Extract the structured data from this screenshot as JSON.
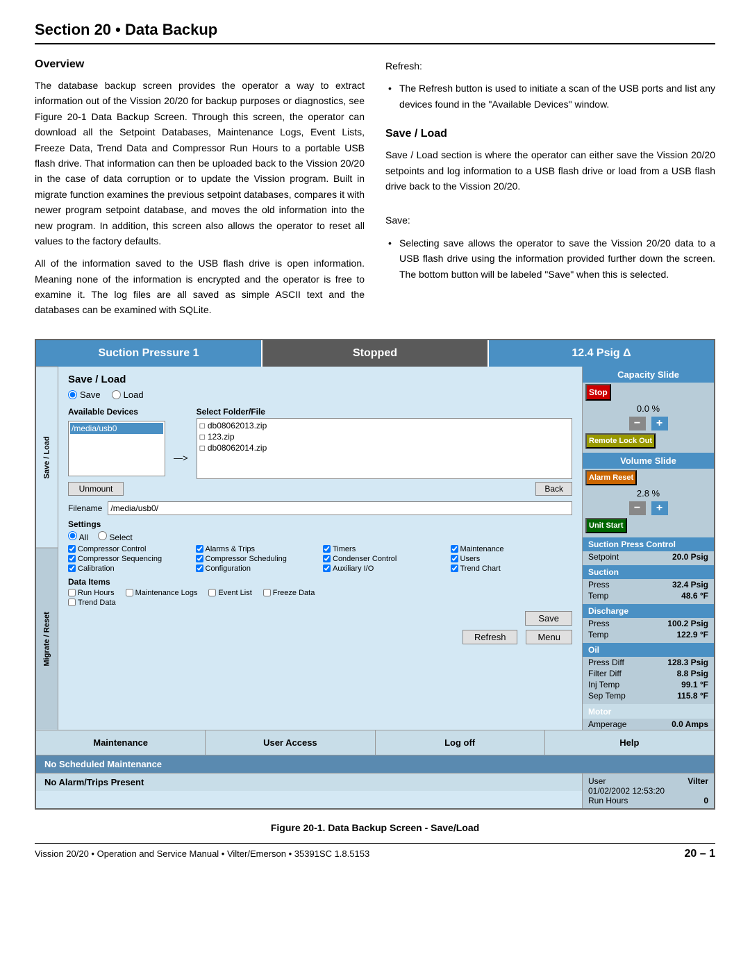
{
  "document": {
    "section_title": "Section 20 • Data Backup",
    "footer_text": "Vission 20/20 • Operation and Service Manual • Vilter/Emerson • 35391SC 1.8.5153",
    "page_number": "20 – 1"
  },
  "overview": {
    "heading": "Overview",
    "paragraph1": "The database backup screen provides the operator a way to extract information out of the Vission 20/20 for backup purposes or diagnostics, see Figure 20-1 Data Backup Screen. Through this screen, the operator can download all the Setpoint Databases, Maintenance Logs, Event Lists, Freeze Data, Trend Data and Compressor Run Hours to a portable USB flash drive. That information can then be uploaded back to the Vission 20/20 in the case of data corruption or to update the Vission program. Built in migrate function examines the previous setpoint databases, compares it with newer program setpoint database, and moves the old information into the new program. In addition, this screen also allows the operator to reset all values to the factory defaults.",
    "paragraph2": "All of the information saved to the USB flash drive is open information. Meaning none of the information is encrypted and the operator is free to examine it. The log files are all saved as simple ASCII text and the databases can be examined with SQLite."
  },
  "refresh_section": {
    "label": "Refresh:",
    "bullet": "The Refresh button is used to initiate a scan of the USB ports and list any devices found in the \"Available Devices\" window."
  },
  "save_load_section": {
    "heading": "Save / Load",
    "intro": "Save / Load section is where the operator can either save the Vission 20/20 setpoints and log information to a USB flash drive or load from a USB flash drive back to the Vission 20/20.",
    "save_label": "Save:",
    "save_bullet": "Selecting save allows the operator to save the Vission 20/20 data to a USB flash drive using the information provided further down the screen. The bottom button will be labeled \"Save\" when this is selected."
  },
  "ui": {
    "top_bar": {
      "left": "Suction Pressure 1",
      "middle": "Stopped",
      "right": "12.4 Psig Δ"
    },
    "sidebar_tabs": [
      "Save / Load",
      "Migrate / Reset"
    ],
    "save_load": {
      "title": "Save / Load",
      "radio_save": "Save",
      "radio_load": "Load",
      "available_devices_label": "Available Devices",
      "select_folder_label": "Select Folder/File",
      "device_item": "/media/usb0",
      "files": [
        "db08062013.zip",
        "123.zip",
        "db08062014.zip"
      ],
      "arrow": "—>",
      "unmount_btn": "Unmount",
      "back_btn": "Back",
      "filename_label": "Filename",
      "filename_value": "/media/usb0/",
      "settings_label": "Settings",
      "settings_all": "All",
      "settings_select": "Select",
      "checkboxes": [
        {
          "label": "Compressor Control",
          "checked": true
        },
        {
          "label": "Alarms & Trips",
          "checked": true
        },
        {
          "label": "Timers",
          "checked": true
        },
        {
          "label": "Maintenance",
          "checked": true
        },
        {
          "label": "Compressor Sequencing",
          "checked": true
        },
        {
          "label": "Compressor Scheduling",
          "checked": true
        },
        {
          "label": "Condenser Control",
          "checked": true
        },
        {
          "label": "Users",
          "checked": true
        },
        {
          "label": "Calibration",
          "checked": true
        },
        {
          "label": "Configuration",
          "checked": true
        },
        {
          "label": "Auxiliary I/O",
          "checked": true
        },
        {
          "label": "Trend Chart",
          "checked": true
        }
      ],
      "data_items_label": "Data Items",
      "data_checkboxes": [
        {
          "label": "Run Hours",
          "checked": false
        },
        {
          "label": "Maintenance Logs",
          "checked": false
        },
        {
          "label": "Event List",
          "checked": false
        },
        {
          "label": "Freeze Data",
          "checked": false
        },
        {
          "label": "Trend Data",
          "checked": false
        }
      ],
      "save_btn": "Save",
      "refresh_btn": "Refresh",
      "menu_btn": "Menu"
    },
    "bottom_bar": {
      "maintenance": "Maintenance",
      "user_access": "User Access",
      "log_off": "Log off",
      "help": "Help"
    },
    "status_bars": {
      "maintenance": "No Scheduled Maintenance",
      "alarms": "No Alarm/Trips Present"
    },
    "footer_info": {
      "user_label": "User",
      "user_value": "Vilter",
      "datetime": "01/02/2002  12:53:20",
      "run_hours_label": "Run Hours",
      "run_hours_value": "0"
    },
    "right_panel": {
      "capacity_title": "Capacity Slide",
      "capacity_value": "0.0 %",
      "stop_btn": "Stop",
      "remote_lock_btn": "Remote Lock Out",
      "volume_title": "Volume Slide",
      "volume_value": "2.8 %",
      "alarm_reset_btn": "Alarm Reset",
      "unit_start_btn": "Unit Start",
      "suction_press_ctrl_title": "Suction Press Control",
      "setpoint_label": "Setpoint",
      "setpoint_value": "20.0 Psig",
      "suction_title": "Suction",
      "suction_press_label": "Press",
      "suction_press_value": "32.4 Psig",
      "suction_temp_label": "Temp",
      "suction_temp_value": "48.6 °F",
      "discharge_title": "Discharge",
      "discharge_press_label": "Press",
      "discharge_press_value": "100.2 Psig",
      "discharge_temp_label": "Temp",
      "discharge_temp_value": "122.9 °F",
      "oil_title": "Oil",
      "oil_press_diff_label": "Press Diff",
      "oil_press_diff_value": "128.3 Psig",
      "oil_filter_diff_label": "Filter Diff",
      "oil_filter_diff_value": "8.8 Psig",
      "oil_inj_temp_label": "Inj Temp",
      "oil_inj_temp_value": "99.1 °F",
      "oil_sep_temp_label": "Sep Temp",
      "oil_sep_temp_value": "115.8 °F",
      "motor_title": "Motor",
      "motor_amperage_label": "Amperage",
      "motor_amperage_value": "0.0 Amps"
    }
  },
  "figure_caption": "Figure 20-1. Data Backup Screen - Save/Load"
}
